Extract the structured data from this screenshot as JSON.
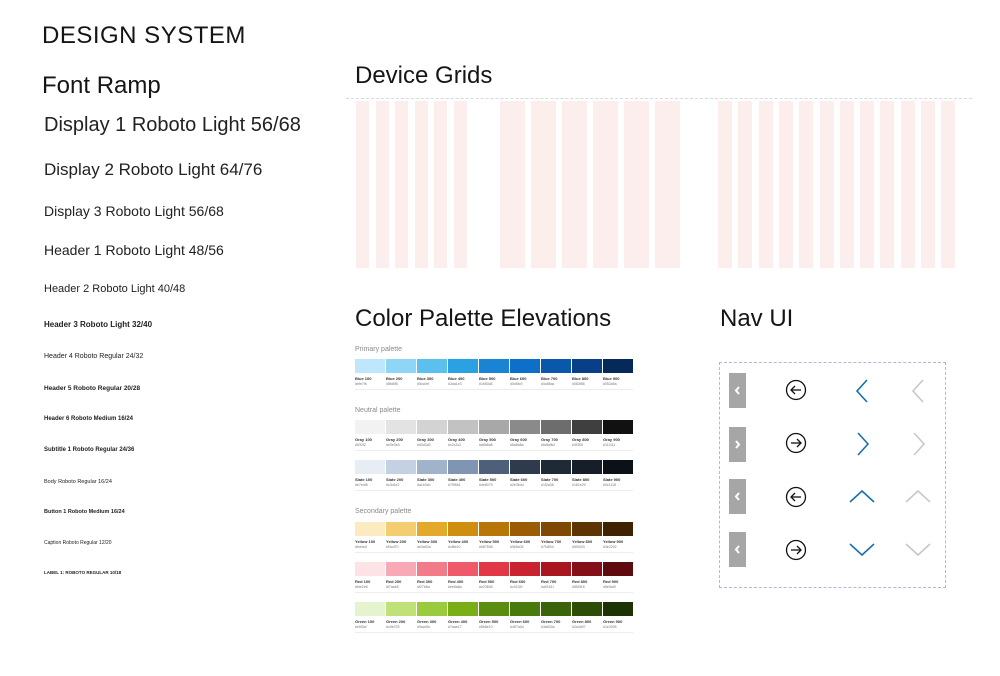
{
  "header": {
    "title": "DESIGN SYSTEM"
  },
  "font_ramp": {
    "heading": "Font Ramp",
    "items": [
      "Display 1 Roboto Light 56/68",
      "Display 2 Roboto Light 64/76",
      "Display 3 Roboto Light 56/68",
      "Header 1 Roboto Light 48/56",
      "Header 2 Roboto Light 40/48",
      "Header 3 Roboto Light 32/40",
      "Header 4 Roboto Regular 24/32",
      "Header 5 Roboto Regular 20/28",
      "Header 6 Roboto Medium 16/24",
      "Subtitle 1 Roboto Regular 24/36",
      "Body Roboto Regular 16/24",
      "Button 1 Roboto Medium 16/24",
      "Caption Roboto Regular 12/20",
      "LABEL 1: ROBOTO REGULAR 10/18"
    ]
  },
  "device_grids": {
    "heading": "Device Grids"
  },
  "palette": {
    "heading": "Color Palette Elevations",
    "primary_label": "Primary palette",
    "neutral_label": "Neutral palette",
    "secondary_label": "Secondary palette",
    "rows": [
      {
        "names": [
          "Blue 100",
          "Blue 200",
          "Blue 300",
          "Blue 400",
          "Blue 500",
          "Blue 600",
          "Blue 700",
          "Blue 800",
          "Blue 900"
        ],
        "colors": [
          "#bfe7fb",
          "#8fd5f6",
          "#5cc0ef",
          "#2aa1e3",
          "#1b83d4",
          "#0d6fc9",
          "#0a58ac",
          "#083f86",
          "#052a5a"
        ]
      },
      {
        "names": [
          "Gray 100",
          "Gray 200",
          "Gray 300",
          "Gray 400",
          "Gray 500",
          "Gray 600",
          "Gray 700",
          "Gray 800",
          "Gray 900"
        ],
        "colors": [
          "#f2f2f2",
          "#e3e3e3",
          "#d3d3d3",
          "#c2c2c2",
          "#a8a8a8",
          "#8a8a8a",
          "#6d6d6d",
          "#3f3f3f",
          "#111111"
        ]
      },
      {
        "names": [
          "Slate 100",
          "Slate 200",
          "Slate 300",
          "Slate 400",
          "Slate 500",
          "Slate 600",
          "Slate 700",
          "Slate 800",
          "Slate 900"
        ],
        "colors": [
          "#e7edf5",
          "#c3d1e2",
          "#a1b3cb",
          "#7f95b1",
          "#4e6079",
          "#2e3b4d",
          "#1f2a38",
          "#161e29",
          "#0c1118"
        ]
      },
      {
        "names": [
          "Yellow 100",
          "Yellow 200",
          "Yellow 300",
          "Yellow 400",
          "Yellow 500",
          "Yellow 600",
          "Yellow 700",
          "Yellow 800",
          "Yellow 900"
        ],
        "colors": [
          "#fcebc0",
          "#f4cd70",
          "#e3a92a",
          "#cf8e10",
          "#b87508",
          "#9b5c05",
          "#7f4804",
          "#5f3403",
          "#3e2202"
        ]
      },
      {
        "names": [
          "Red 100",
          "Red 200",
          "Red 300",
          "Red 400",
          "Red 500",
          "Red 600",
          "Red 700",
          "Red 800",
          "Red 900"
        ],
        "colors": [
          "#fde2e6",
          "#f7aab5",
          "#f27b8a",
          "#ee5a6a",
          "#e23845",
          "#c9232f",
          "#a9161f",
          "#850f16",
          "#5e0a0f"
        ]
      },
      {
        "names": [
          "Green 100",
          "Green 200",
          "Green 300",
          "Green 400",
          "Green 500",
          "Green 600",
          "Green 700",
          "Green 800",
          "Green 900"
        ],
        "colors": [
          "#e5f3cf",
          "#c0e078",
          "#9acb3c",
          "#7aae17",
          "#5b8e10",
          "#487a0d",
          "#3a630a",
          "#2d4d07",
          "#1e3305"
        ]
      }
    ]
  },
  "nav_ui": {
    "heading": "Nav UI"
  },
  "colors": {
    "grid_column": "#fdeeee",
    "nav_blue": "#1a6fb0",
    "nav_gray": "#c8c8c8",
    "tab_gray": "#a6a6a6"
  }
}
